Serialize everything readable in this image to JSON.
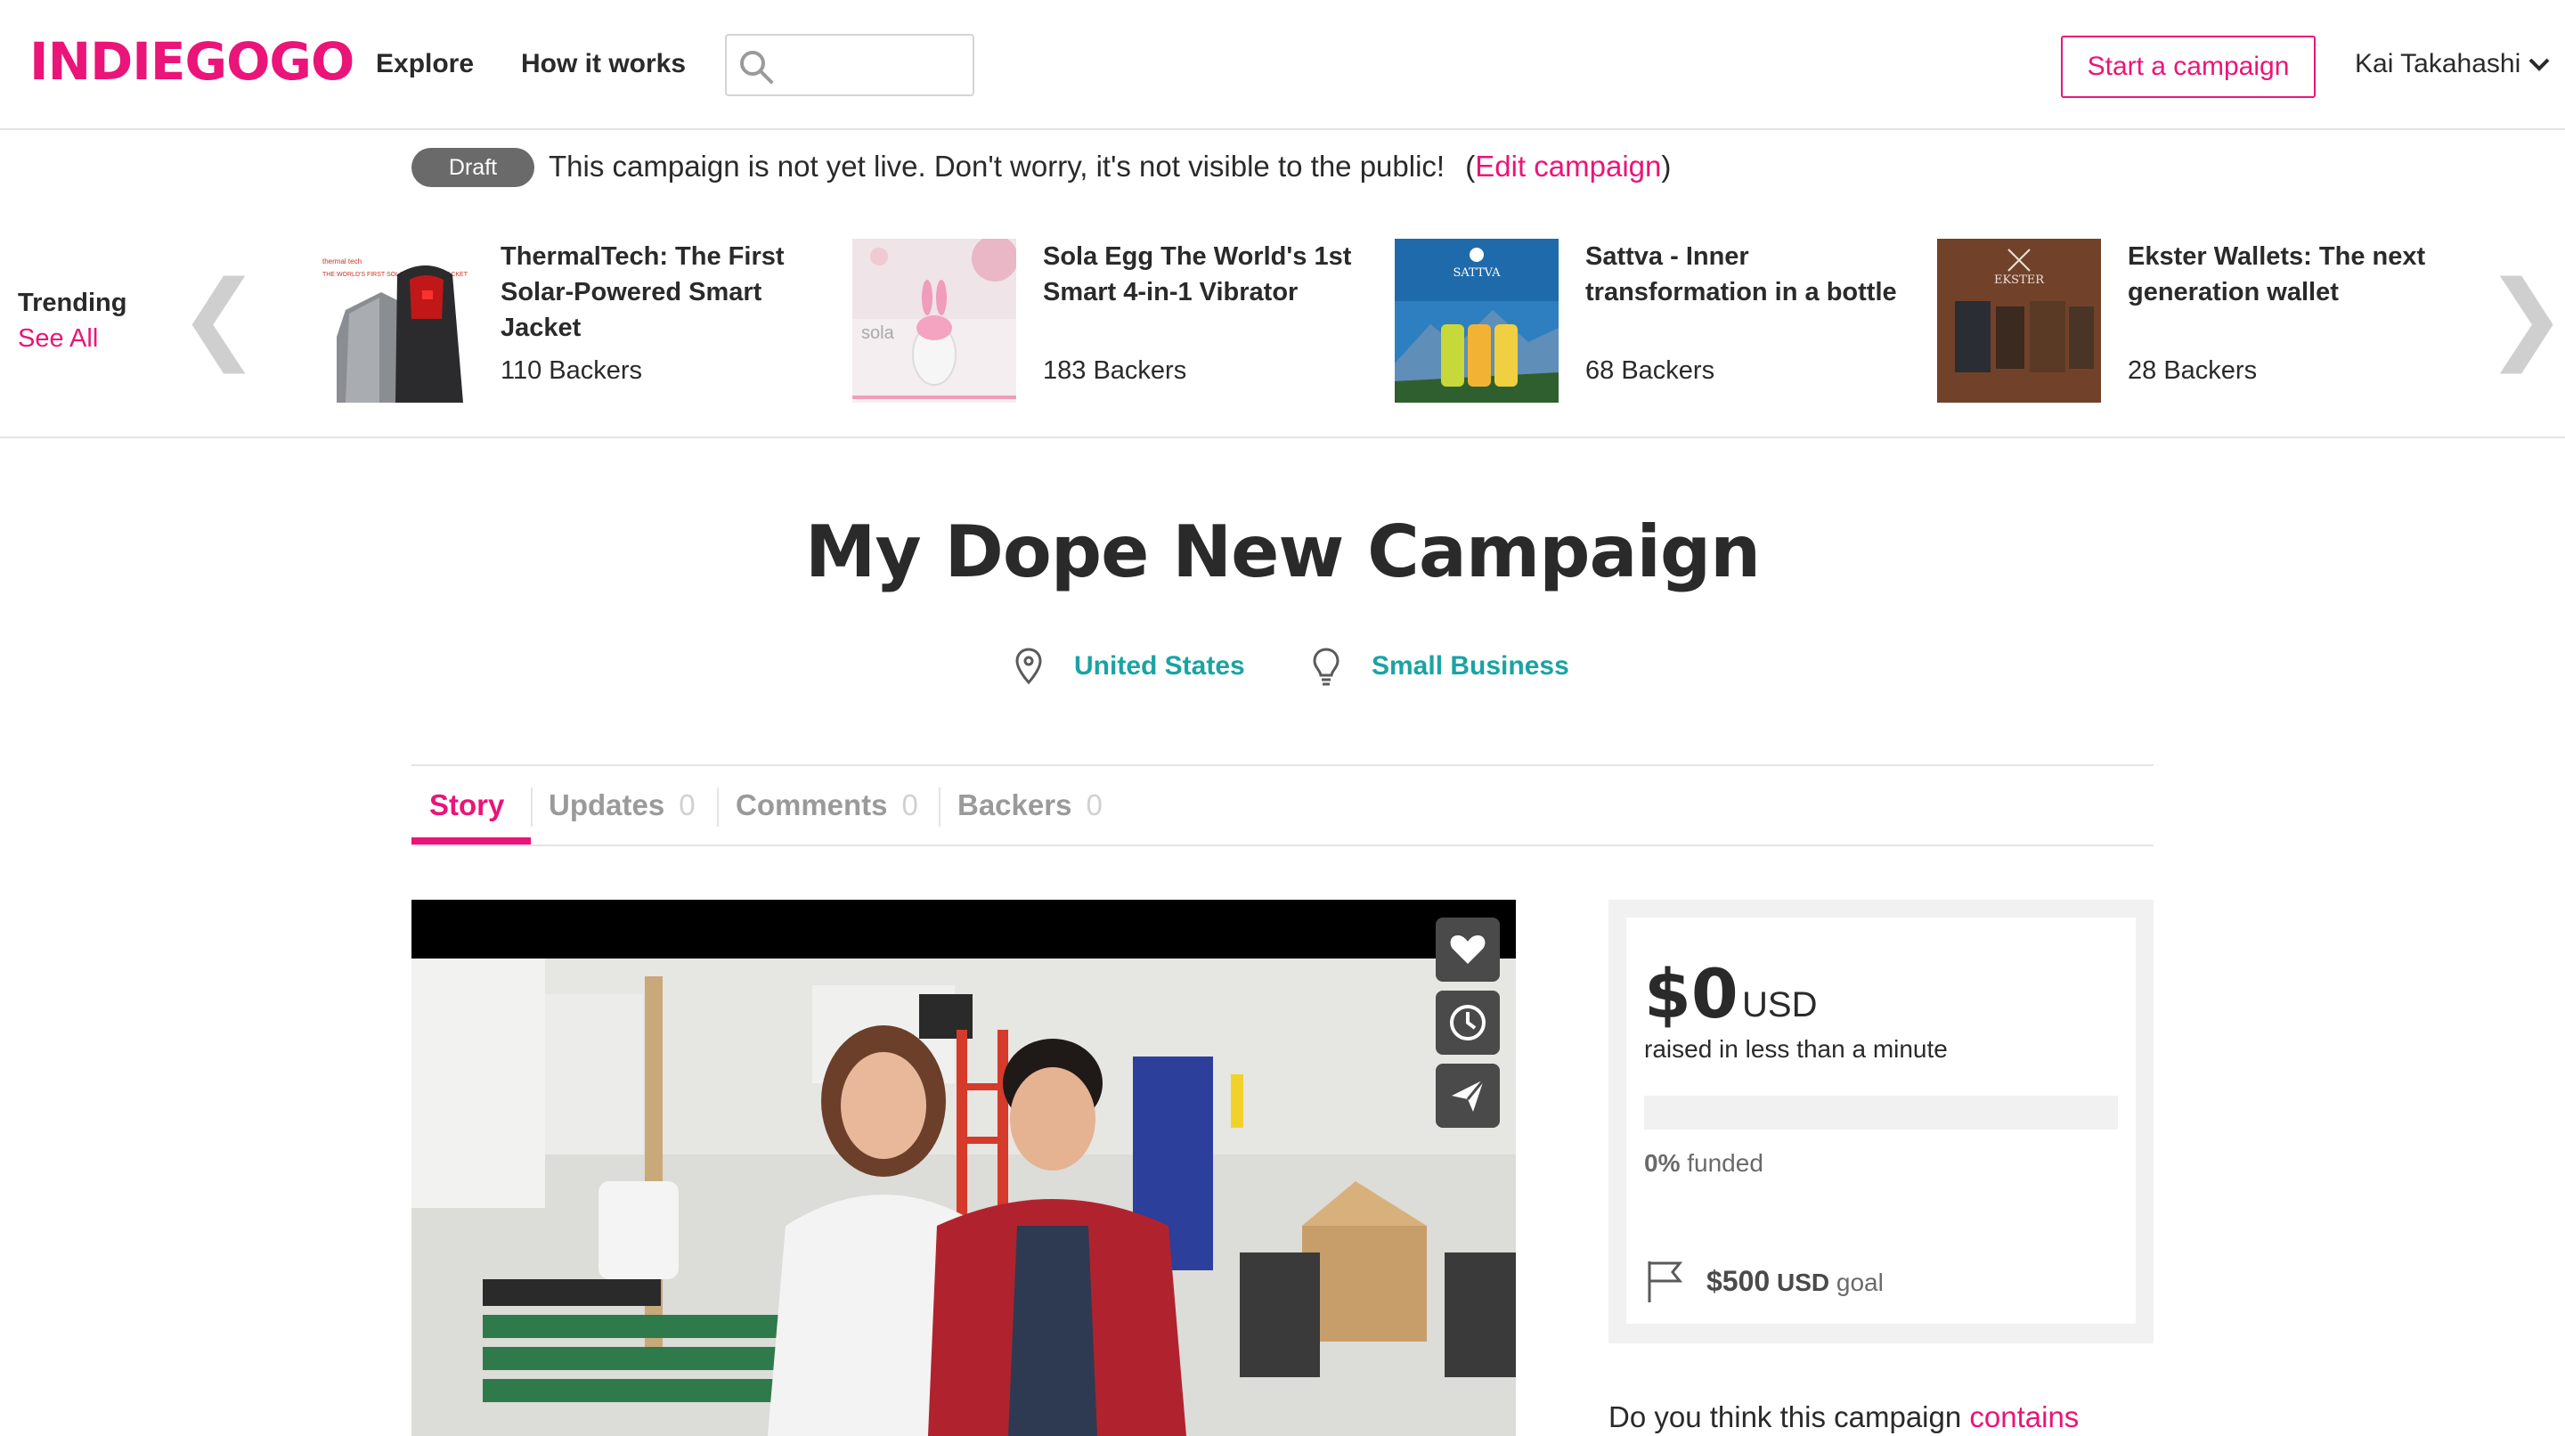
{
  "header": {
    "logo": "INDIEGOGO",
    "nav": [
      "Explore",
      "How it works"
    ],
    "search_placeholder": "",
    "start_campaign_label": "Start a campaign",
    "user_name": "Kai Takahashi",
    "brand_color": "#eb1478"
  },
  "draft_bar": {
    "badge": "Draft",
    "message": "This campaign is not yet live. Don't worry, it's not visible to the public!",
    "open_paren": "(",
    "edit_link": "Edit campaign",
    "close_paren": ")"
  },
  "trending": {
    "heading": "Trending",
    "see_all": "See All",
    "prev_icon": "chevron-left-icon",
    "next_icon": "chevron-right-icon",
    "items": [
      {
        "title": "ThermalTech: The First Solar-Powered Smart Jacket",
        "backers": "110 Backers",
        "thumb_text": "THE WORLD'S FIRST SOLAR-POWERED JACKET"
      },
      {
        "title": "Sola Egg The World's 1st Smart 4-in-1 Vibrator",
        "backers": "183 Backers",
        "thumb_text": "sola"
      },
      {
        "title": "Sattva - Inner transformation in a bottle",
        "backers": "68 Backers",
        "thumb_text": "SATTVA"
      },
      {
        "title": "Ekster Wallets: The next generation wallet",
        "backers": "28 Backers",
        "thumb_text": "EKSTER"
      }
    ]
  },
  "campaign": {
    "title": "My Dope New Campaign",
    "location": "United States",
    "category": "Small Business",
    "meta_color": "#1aa3a3"
  },
  "tabs": [
    {
      "label": "Story",
      "count": "",
      "active": true
    },
    {
      "label": "Updates",
      "count": "0",
      "active": false
    },
    {
      "label": "Comments",
      "count": "0",
      "active": false
    },
    {
      "label": "Backers",
      "count": "0",
      "active": false
    }
  ],
  "video": {
    "actions": [
      "heart-icon",
      "clock-icon",
      "share-plane-icon"
    ]
  },
  "funding": {
    "amount": "$0",
    "currency": "USD",
    "raised_text": "raised in less than a minute",
    "funded_fraction": 0,
    "funded_percent": "0%",
    "funded_label": "funded",
    "goal_amount": "$500",
    "goal_currency": "USD",
    "goal_label": "goal"
  },
  "report": {
    "question": "Do you think this campaign",
    "link": "contains"
  }
}
